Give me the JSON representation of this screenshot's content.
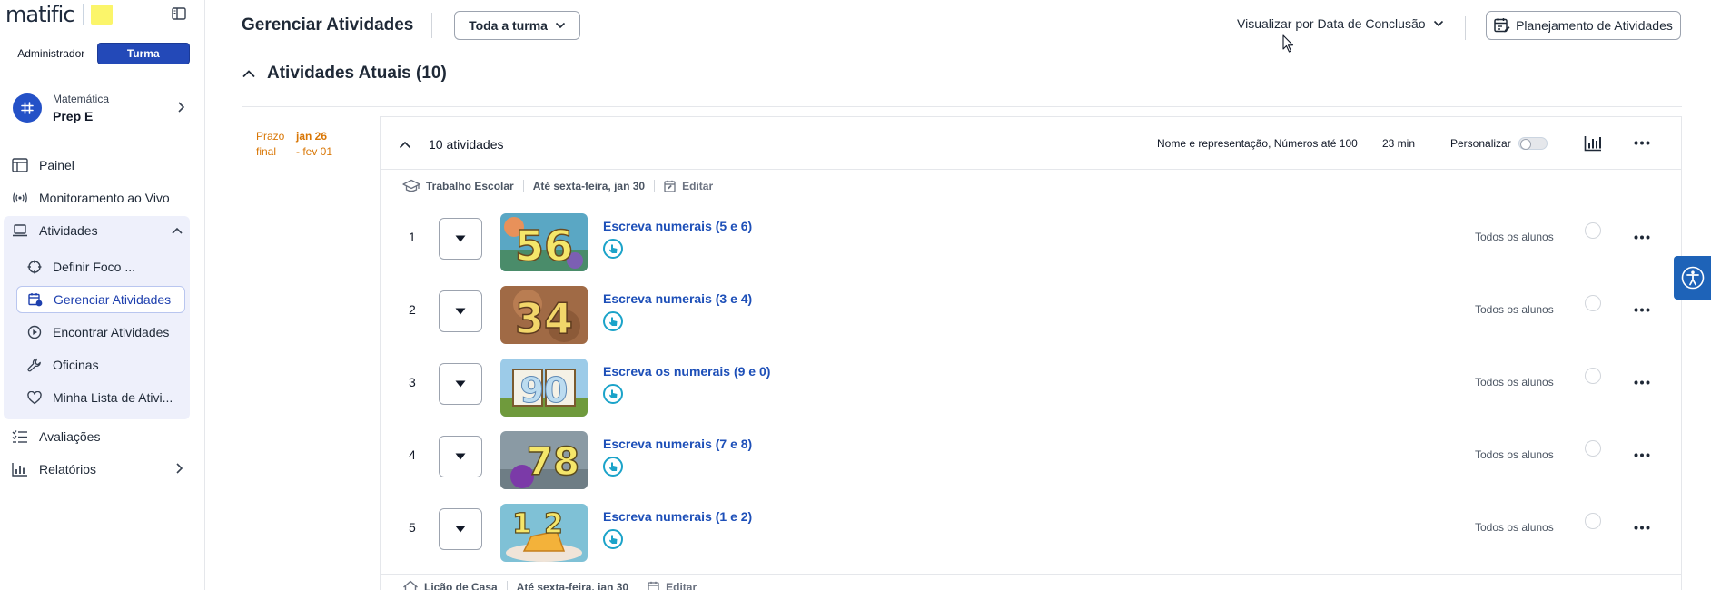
{
  "brand": {
    "logo_text": "matific"
  },
  "roles": {
    "admin_label": "Administrador",
    "class_label": "Turma"
  },
  "current_class": {
    "subject": "Matemática",
    "name": "Prep E"
  },
  "nav": {
    "dashboard": "Painel",
    "live": "Monitoramento ao Vivo",
    "activities": "Atividades",
    "set_focus": "Definir Foco ...",
    "manage": "Gerenciar Atividades",
    "find": "Encontrar Atividades",
    "workshops": "Oficinas",
    "wishlist": "Minha Lista de Ativi...",
    "assessments": "Avaliações",
    "reports": "Relatórios"
  },
  "header": {
    "title": "Gerenciar Atividades",
    "class_filter": "Toda a turma",
    "view_by": "Visualizar por Data de Conclusão",
    "planning_button": "Planejamento de Atividades"
  },
  "section": {
    "title": "Atividades Atuais (10)"
  },
  "deadline": {
    "label_line1": "Prazo",
    "label_line2": "final",
    "date_line1": "jan 26",
    "date_line2": "- fev 01"
  },
  "group": {
    "count": "10 atividades",
    "topics": "Nome e representação, Números até 100",
    "duration": "23 min",
    "personalize": "Personalizar"
  },
  "assignment": {
    "type": "Trabalho Escolar",
    "due": "Até sexta-feira, jan 30",
    "edit": "Editar"
  },
  "activities": [
    {
      "num": "1",
      "title": "Escreva numerais (5 e 6)",
      "audience": "Todos os alunos",
      "thumb_digits": "56"
    },
    {
      "num": "2",
      "title": "Escreva numerais (3 e 4)",
      "audience": "Todos os alunos",
      "thumb_digits": "34"
    },
    {
      "num": "3",
      "title": "Escreva os numerais (9 e 0)",
      "audience": "Todos os alunos",
      "thumb_digits": "90"
    },
    {
      "num": "4",
      "title": "Escreva numerais (7 e 8)",
      "audience": "Todos os alunos",
      "thumb_digits": "78"
    },
    {
      "num": "5",
      "title": "Escreva numerais (1 e 2)",
      "audience": "Todos os alunos",
      "thumb_digits": "12"
    }
  ],
  "next_assignment": {
    "type": "Lição de Casa",
    "due": "Até sexta-feira, jan 30",
    "edit": "Editar"
  },
  "colors": {
    "primary": "#2349b8",
    "link": "#1d4fb8",
    "deadline": "#d97706",
    "nav_group_bg": "#eef0fb"
  }
}
